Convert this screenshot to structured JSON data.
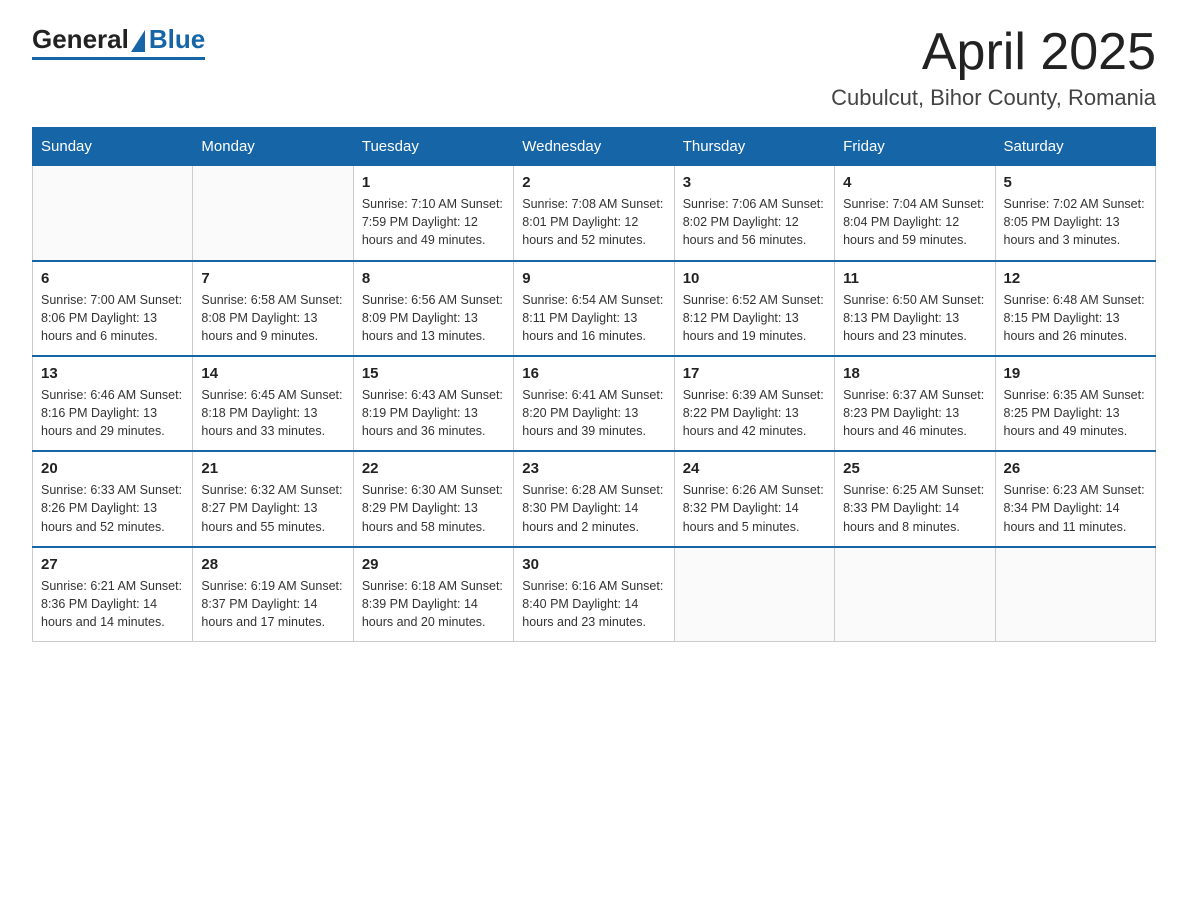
{
  "header": {
    "logo_general": "General",
    "logo_blue": "Blue",
    "month_title": "April 2025",
    "location": "Cubulcut, Bihor County, Romania"
  },
  "calendar": {
    "days_of_week": [
      "Sunday",
      "Monday",
      "Tuesday",
      "Wednesday",
      "Thursday",
      "Friday",
      "Saturday"
    ],
    "weeks": [
      [
        {
          "day": "",
          "info": ""
        },
        {
          "day": "",
          "info": ""
        },
        {
          "day": "1",
          "info": "Sunrise: 7:10 AM\nSunset: 7:59 PM\nDaylight: 12 hours\nand 49 minutes."
        },
        {
          "day": "2",
          "info": "Sunrise: 7:08 AM\nSunset: 8:01 PM\nDaylight: 12 hours\nand 52 minutes."
        },
        {
          "day": "3",
          "info": "Sunrise: 7:06 AM\nSunset: 8:02 PM\nDaylight: 12 hours\nand 56 minutes."
        },
        {
          "day": "4",
          "info": "Sunrise: 7:04 AM\nSunset: 8:04 PM\nDaylight: 12 hours\nand 59 minutes."
        },
        {
          "day": "5",
          "info": "Sunrise: 7:02 AM\nSunset: 8:05 PM\nDaylight: 13 hours\nand 3 minutes."
        }
      ],
      [
        {
          "day": "6",
          "info": "Sunrise: 7:00 AM\nSunset: 8:06 PM\nDaylight: 13 hours\nand 6 minutes."
        },
        {
          "day": "7",
          "info": "Sunrise: 6:58 AM\nSunset: 8:08 PM\nDaylight: 13 hours\nand 9 minutes."
        },
        {
          "day": "8",
          "info": "Sunrise: 6:56 AM\nSunset: 8:09 PM\nDaylight: 13 hours\nand 13 minutes."
        },
        {
          "day": "9",
          "info": "Sunrise: 6:54 AM\nSunset: 8:11 PM\nDaylight: 13 hours\nand 16 minutes."
        },
        {
          "day": "10",
          "info": "Sunrise: 6:52 AM\nSunset: 8:12 PM\nDaylight: 13 hours\nand 19 minutes."
        },
        {
          "day": "11",
          "info": "Sunrise: 6:50 AM\nSunset: 8:13 PM\nDaylight: 13 hours\nand 23 minutes."
        },
        {
          "day": "12",
          "info": "Sunrise: 6:48 AM\nSunset: 8:15 PM\nDaylight: 13 hours\nand 26 minutes."
        }
      ],
      [
        {
          "day": "13",
          "info": "Sunrise: 6:46 AM\nSunset: 8:16 PM\nDaylight: 13 hours\nand 29 minutes."
        },
        {
          "day": "14",
          "info": "Sunrise: 6:45 AM\nSunset: 8:18 PM\nDaylight: 13 hours\nand 33 minutes."
        },
        {
          "day": "15",
          "info": "Sunrise: 6:43 AM\nSunset: 8:19 PM\nDaylight: 13 hours\nand 36 minutes."
        },
        {
          "day": "16",
          "info": "Sunrise: 6:41 AM\nSunset: 8:20 PM\nDaylight: 13 hours\nand 39 minutes."
        },
        {
          "day": "17",
          "info": "Sunrise: 6:39 AM\nSunset: 8:22 PM\nDaylight: 13 hours\nand 42 minutes."
        },
        {
          "day": "18",
          "info": "Sunrise: 6:37 AM\nSunset: 8:23 PM\nDaylight: 13 hours\nand 46 minutes."
        },
        {
          "day": "19",
          "info": "Sunrise: 6:35 AM\nSunset: 8:25 PM\nDaylight: 13 hours\nand 49 minutes."
        }
      ],
      [
        {
          "day": "20",
          "info": "Sunrise: 6:33 AM\nSunset: 8:26 PM\nDaylight: 13 hours\nand 52 minutes."
        },
        {
          "day": "21",
          "info": "Sunrise: 6:32 AM\nSunset: 8:27 PM\nDaylight: 13 hours\nand 55 minutes."
        },
        {
          "day": "22",
          "info": "Sunrise: 6:30 AM\nSunset: 8:29 PM\nDaylight: 13 hours\nand 58 minutes."
        },
        {
          "day": "23",
          "info": "Sunrise: 6:28 AM\nSunset: 8:30 PM\nDaylight: 14 hours\nand 2 minutes."
        },
        {
          "day": "24",
          "info": "Sunrise: 6:26 AM\nSunset: 8:32 PM\nDaylight: 14 hours\nand 5 minutes."
        },
        {
          "day": "25",
          "info": "Sunrise: 6:25 AM\nSunset: 8:33 PM\nDaylight: 14 hours\nand 8 minutes."
        },
        {
          "day": "26",
          "info": "Sunrise: 6:23 AM\nSunset: 8:34 PM\nDaylight: 14 hours\nand 11 minutes."
        }
      ],
      [
        {
          "day": "27",
          "info": "Sunrise: 6:21 AM\nSunset: 8:36 PM\nDaylight: 14 hours\nand 14 minutes."
        },
        {
          "day": "28",
          "info": "Sunrise: 6:19 AM\nSunset: 8:37 PM\nDaylight: 14 hours\nand 17 minutes."
        },
        {
          "day": "29",
          "info": "Sunrise: 6:18 AM\nSunset: 8:39 PM\nDaylight: 14 hours\nand 20 minutes."
        },
        {
          "day": "30",
          "info": "Sunrise: 6:16 AM\nSunset: 8:40 PM\nDaylight: 14 hours\nand 23 minutes."
        },
        {
          "day": "",
          "info": ""
        },
        {
          "day": "",
          "info": ""
        },
        {
          "day": "",
          "info": ""
        }
      ]
    ]
  }
}
